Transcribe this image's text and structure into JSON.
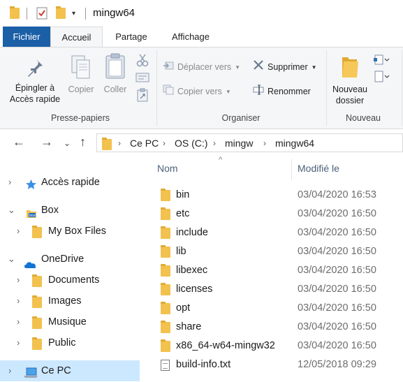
{
  "window": {
    "title": "mingw64"
  },
  "ribbon_tabs": {
    "file": "Fichier",
    "home": "Accueil",
    "share": "Partage",
    "view": "Affichage"
  },
  "clipboard": {
    "pin_line1": "Épingler à",
    "pin_line2": "Accès rapide",
    "copy": "Copier",
    "paste": "Coller",
    "group_label": "Presse-papiers"
  },
  "organize": {
    "move_to": "Déplacer vers",
    "copy_to": "Copier vers",
    "delete": "Supprimer",
    "rename": "Renommer",
    "group_label": "Organiser"
  },
  "new": {
    "new_folder_line1": "Nouveau",
    "new_folder_line2": "dossier",
    "group_label": "Nouveau"
  },
  "address": {
    "crumbs": [
      "Ce PC",
      "OS (C:)",
      "mingw",
      "mingw64"
    ]
  },
  "nav_tree": [
    {
      "label": "Accès rapide",
      "icon": "star-icon"
    },
    {
      "label": "Box",
      "icon": "box-icon"
    },
    {
      "label": "My Box Files",
      "icon": "folder-icon"
    },
    {
      "label": "OneDrive",
      "icon": "cloud-icon"
    },
    {
      "label": "Documents",
      "icon": "folder-icon"
    },
    {
      "label": "Images",
      "icon": "folder-icon"
    },
    {
      "label": "Musique",
      "icon": "folder-icon"
    },
    {
      "label": "Public",
      "icon": "folder-icon"
    },
    {
      "label": "Ce PC",
      "icon": "computer-icon"
    }
  ],
  "columns": {
    "name": "Nom",
    "modified": "Modifié le"
  },
  "files": [
    {
      "name": "bin",
      "date": "03/04/2020 16:53",
      "type": "folder"
    },
    {
      "name": "etc",
      "date": "03/04/2020 16:50",
      "type": "folder"
    },
    {
      "name": "include",
      "date": "03/04/2020 16:50",
      "type": "folder"
    },
    {
      "name": "lib",
      "date": "03/04/2020 16:50",
      "type": "folder"
    },
    {
      "name": "libexec",
      "date": "03/04/2020 16:50",
      "type": "folder"
    },
    {
      "name": "licenses",
      "date": "03/04/2020 16:50",
      "type": "folder"
    },
    {
      "name": "opt",
      "date": "03/04/2020 16:50",
      "type": "folder"
    },
    {
      "name": "share",
      "date": "03/04/2020 16:50",
      "type": "folder"
    },
    {
      "name": "x86_64-w64-mingw32",
      "date": "03/04/2020 16:50",
      "type": "folder"
    },
    {
      "name": "build-info.txt",
      "date": "12/05/2018 09:29",
      "type": "text-file"
    }
  ],
  "colors": {
    "accent": "#1b5fa7",
    "folder": "#f2c14e",
    "selection": "#cce8ff"
  }
}
